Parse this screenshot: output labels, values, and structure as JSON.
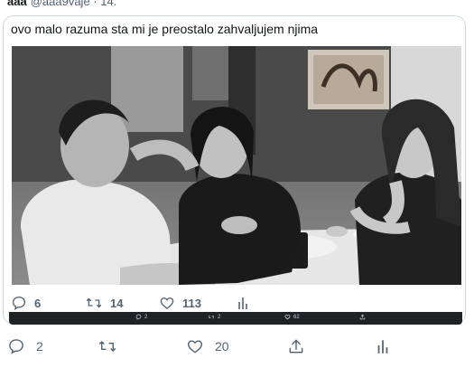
{
  "header": {
    "display_name": "ааа",
    "handle": "@aaa9vaje · 14."
  },
  "quote": {
    "text": "ovo malo razuma sta mi je preostalo zahvaljujem njima",
    "photo_description_icon": "photo",
    "actions": {
      "replies": "6",
      "retweets": "14",
      "likes": "113"
    }
  },
  "dark_strip": {
    "replies": "2",
    "retweets": "2",
    "likes": "62"
  },
  "tweet_actions": {
    "replies": "2",
    "retweets": "",
    "likes": "20"
  },
  "colors": {
    "icon_gray": "#536471",
    "border": "#cfd9de",
    "text": "#0f1419"
  }
}
